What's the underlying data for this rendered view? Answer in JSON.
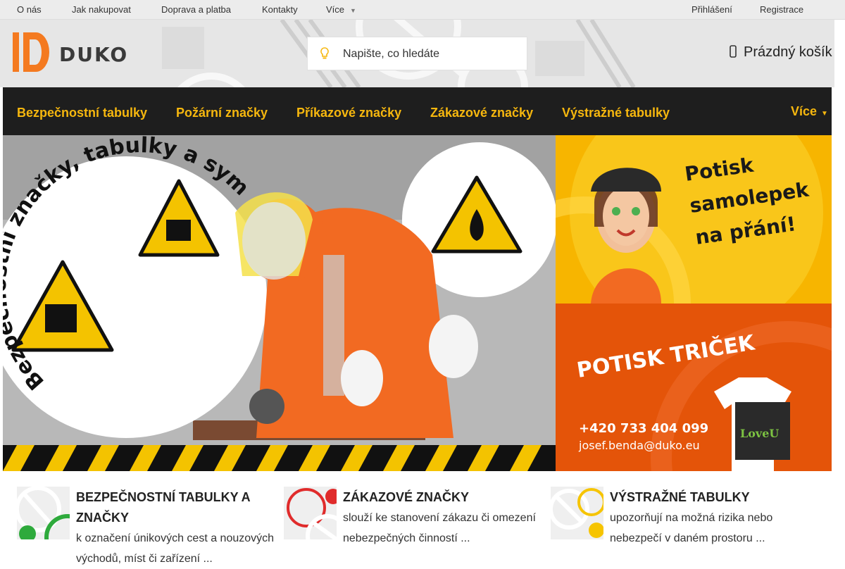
{
  "topbar": {
    "links": [
      "O nás",
      "Jak nakupovat",
      "Doprava a platba",
      "Kontakty"
    ],
    "more_label": "Více",
    "login": "Přihlášení",
    "register": "Registrace"
  },
  "header": {
    "logo_text": "DUKO",
    "search_placeholder": "Napište, co hledáte",
    "cart_label": "Prázdný košík"
  },
  "nav": {
    "items": [
      "Bezpečnostní tabulky",
      "Požární značky",
      "Příkazové značky",
      "Zákazové značky",
      "Výstražné tabulky"
    ],
    "more_label": "Více"
  },
  "hero": {
    "curved_text": "Bezpečnostní značky, tabulky a symboly"
  },
  "promo_stickers": {
    "lines": [
      "Potisk",
      "samolepek",
      "na přání!"
    ]
  },
  "promo_tshirts": {
    "title": "POTISK TRIČEK",
    "phone": "+420 733 404 099",
    "email": "josef.benda@duko.eu",
    "shirt_text": "LoveU"
  },
  "categories": [
    {
      "title": "BEZPEČNOSTNÍ TABULKY A ZNAČKY",
      "desc": "k označení únikových cest a nouzových východů, míst či zařízení ..."
    },
    {
      "title": "ZÁKAZOVÉ ZNAČKY",
      "desc": "slouží ke stanovení zákazu či omezení nebezpečných činností ..."
    },
    {
      "title": "VÝSTRAŽNÉ TABULKY",
      "desc": "upozorňují na možná rizika nebo nebezpečí v daném prostoru ..."
    }
  ],
  "colors": {
    "nav_bg": "#1e1e1e",
    "nav_text": "#f6b70e",
    "logo_orange": "#f47a20",
    "promo_yellow": "#f7b500",
    "promo_orange": "#e45409"
  },
  "icons": {
    "search": "lightbulb-icon",
    "cart": "cart-icon",
    "caret": "chevron-down-icon"
  }
}
